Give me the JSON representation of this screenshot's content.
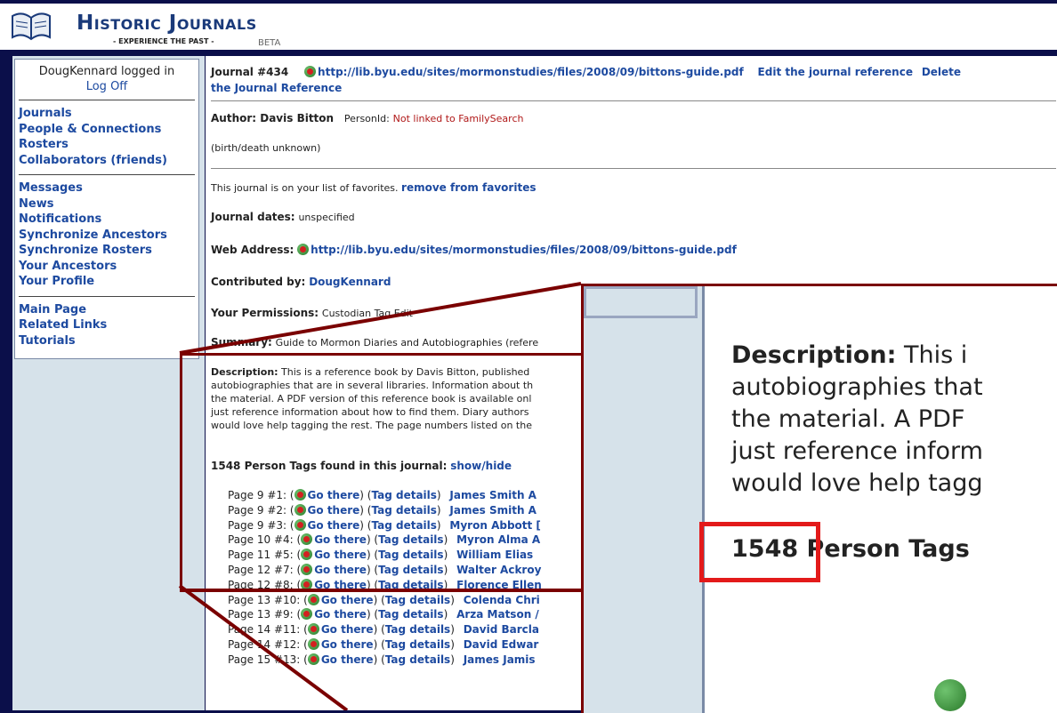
{
  "header": {
    "title": "Historic Journals",
    "tagline": "- EXPERIENCE THE PAST -",
    "beta": "BETA"
  },
  "sidebar": {
    "login_text": "DougKennard logged in",
    "logoff": "Log Off",
    "group1": [
      "Journals",
      "People & Connections",
      "Rosters",
      "Collaborators (friends)"
    ],
    "group2": [
      "Messages",
      "News",
      "Notifications",
      "Synchronize Ancestors",
      "Synchronize Rosters",
      "Your Ancestors",
      "Your Profile"
    ],
    "group3": [
      "Main Page",
      "Related Links",
      "Tutorials"
    ]
  },
  "journal": {
    "number": "Journal #434",
    "url": "http://lib.byu.edu/sites/mormonstudies/files/2008/09/bittons-guide.pdf",
    "edit_link": "Edit the journal reference",
    "delete_link_1": "Delete",
    "delete_link_2": "the Journal Reference",
    "author_label": "Author: Davis Bitton",
    "personid_label": "PersonId:",
    "personid_value": "Not linked to FamilySearch",
    "birth_death": "(birth/death unknown)",
    "favorites_text": "This journal is on your list of favorites.",
    "favorites_link": "remove from favorites",
    "dates_label": "Journal dates:",
    "dates_value": "unspecified",
    "web_label": "Web Address:",
    "contrib_label": "Contributed by:",
    "contrib_value": "DougKennard",
    "perm_label": "Your Permissions:",
    "perm_value": "Custodian Tag Edit",
    "summary_label": "Summary:",
    "summary_value": "Guide to Mormon Diaries and Autobiographies (refere",
    "desc_label": "Description:",
    "desc_lines": [
      "This is a reference book by Davis Bitton, published",
      "autobiographies that are in several libraries. Information about th",
      "the material. A PDF version of this reference book is available onl",
      "just reference information about how to find them. Diary authors",
      "would love help tagging the rest. The page numbers listed on the"
    ],
    "tags_found": "1548 Person Tags found in this journal:",
    "show_hide": "show/hide"
  },
  "tags": [
    {
      "page": "Page 9 #1:",
      "name": "James Smith A"
    },
    {
      "page": "Page 9 #2:",
      "name": "James Smith A"
    },
    {
      "page": "Page 9 #3:",
      "name": "Myron Abbott ["
    },
    {
      "page": "Page 10 #4:",
      "name": "Myron Alma A"
    },
    {
      "page": "Page 11 #5:",
      "name": "William Elias"
    },
    {
      "page": "Page 12 #7:",
      "name": "Walter Ackroy"
    },
    {
      "page": "Page 12 #8:",
      "name": "Florence Ellen"
    },
    {
      "page": "Page 13 #10:",
      "name": "Colenda Chri"
    },
    {
      "page": "Page 13 #9:",
      "name": "Arza Matson /"
    },
    {
      "page": "Page 14 #11:",
      "name": "David Barcla"
    },
    {
      "page": "Page 14 #12:",
      "name": "David Edwar"
    },
    {
      "page": "Page 15 #13:",
      "name": "James Jamis"
    }
  ],
  "tag_link_go": "Go there",
  "tag_link_details": "Tag details",
  "zoom": {
    "label": "Description:",
    "line1_rest": " This i",
    "line2": "autobiographies that",
    "line3": "the material. A PDF",
    "line4": "just reference inform",
    "line5": "would love help tagg",
    "count": "1548",
    "count_rest": " Person Tags"
  },
  "colors": {
    "accent": "#1d4aa0",
    "highlight": "#e31a1a",
    "callout": "#7a0000",
    "frame": "#0b0f4a"
  }
}
